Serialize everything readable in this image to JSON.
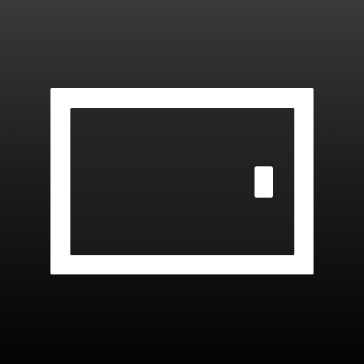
{
  "icon": {
    "name": "picture-in-picture-app-icon",
    "colors": {
      "background_top": "#3a3a3a",
      "background_bottom": "#030303",
      "frame": "#ffffff",
      "pane": "#1f1f1f",
      "pip": "#ffffff"
    }
  }
}
